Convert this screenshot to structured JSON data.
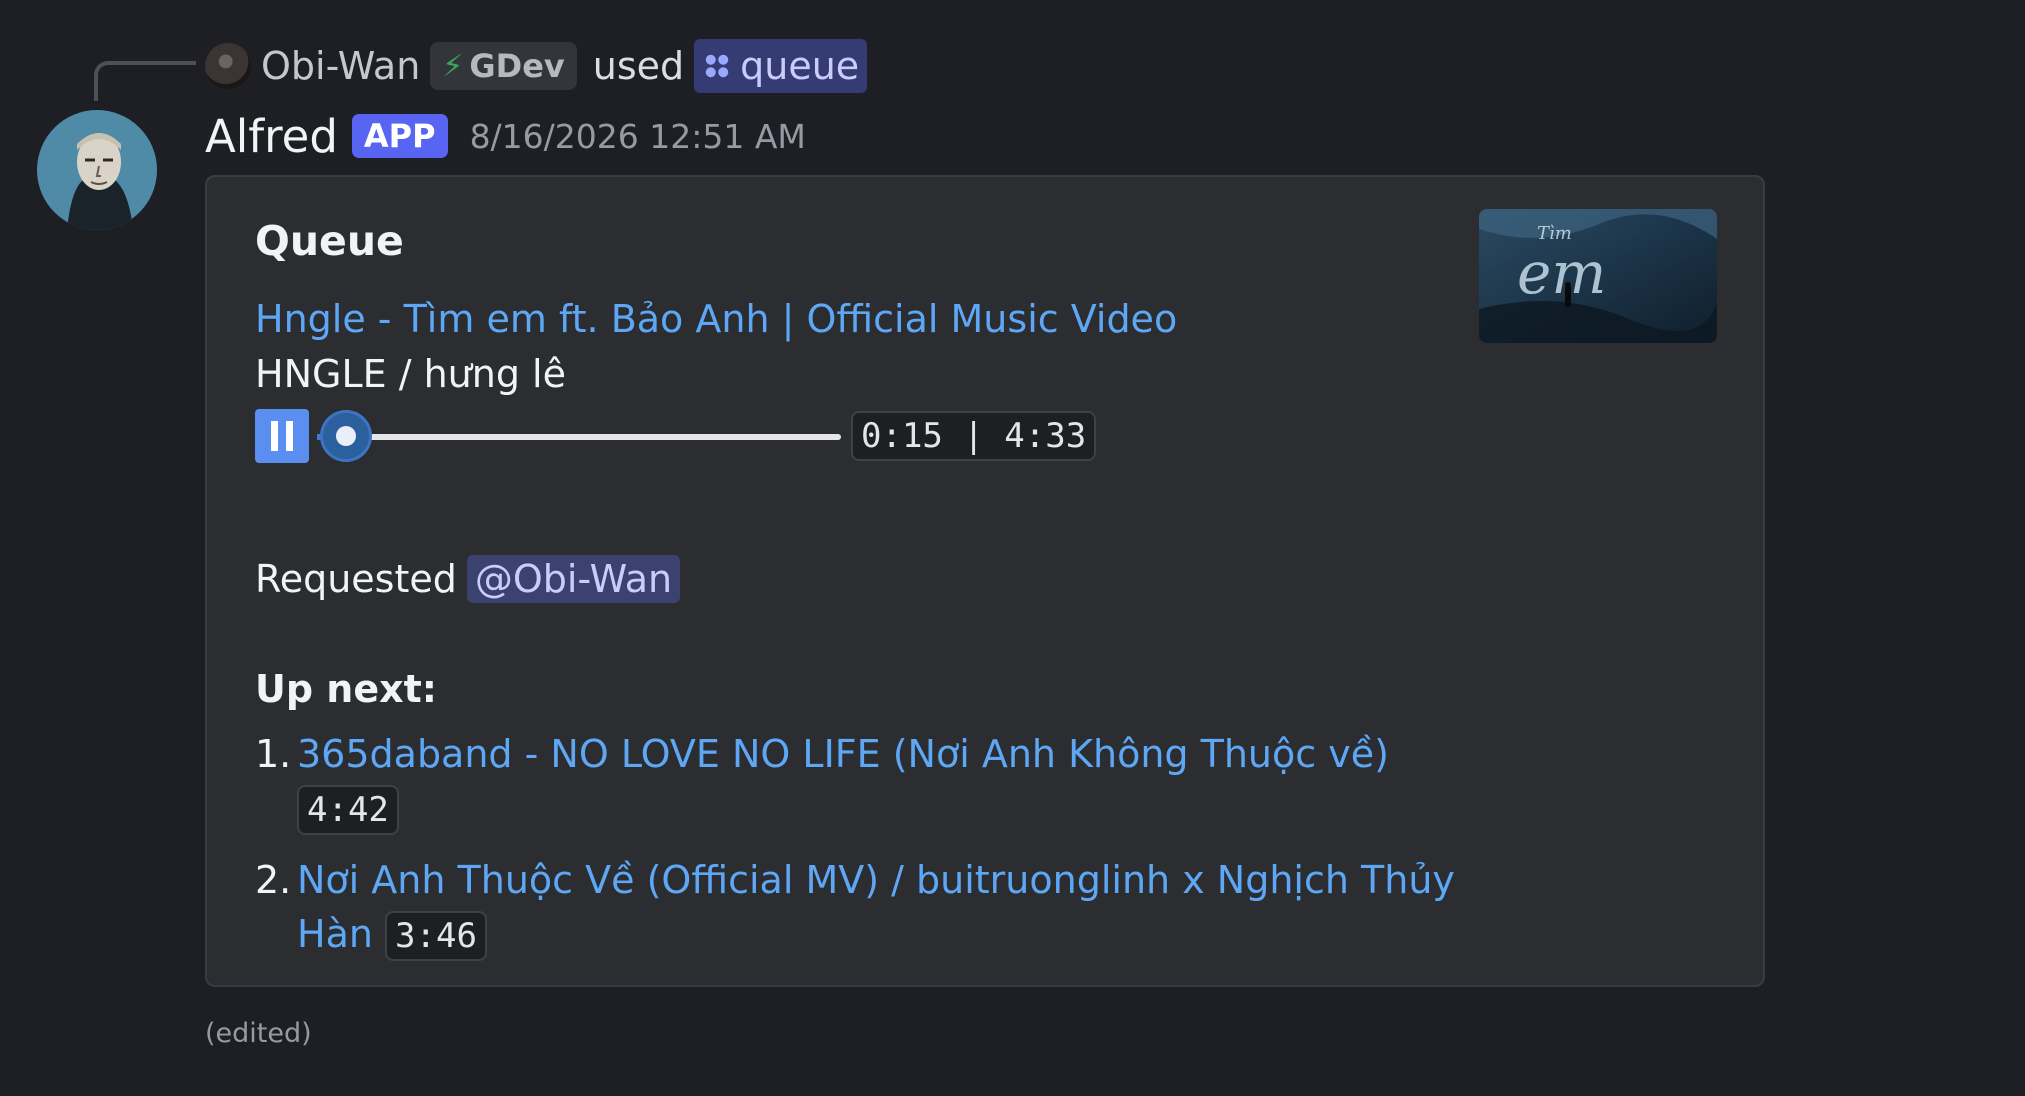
{
  "reply": {
    "user": "Obi-Wan",
    "tag": "GDev",
    "used_text": "used",
    "command": "queue"
  },
  "message": {
    "author": "Alfred",
    "badge": "APP",
    "timestamp": "8/16/2026 12:51 AM",
    "edited": "(edited)"
  },
  "embed": {
    "title": "Queue",
    "now_playing": {
      "title": "Hngle - Tìm em ft. Bảo Anh | Official Music Video",
      "artist": "HNGLE / hưng lê",
      "time": "0:15 | 4:33",
      "progress_fraction": 0.055
    },
    "requested_label": "Requested",
    "requested_by": "@Obi-Wan",
    "up_next_label": "Up next:",
    "queue": [
      {
        "num": "1.",
        "title": "365daband - NO LOVE NO LIFE (Nơi Anh Không Thuộc về)",
        "duration": "4:42"
      },
      {
        "num": "2.",
        "title": "Nơi Anh Thuộc Về (Official MV) / buitruonglinh x Nghịch Thủy Hàn",
        "duration": "3:46"
      }
    ],
    "thumbnail_text": "Tìm em"
  },
  "colors": {
    "background": "#1e1f24",
    "embed": "#2b2d31",
    "link": "#5ea7f5",
    "badge": "#5865f2",
    "mention_bg": "#3c4270"
  }
}
